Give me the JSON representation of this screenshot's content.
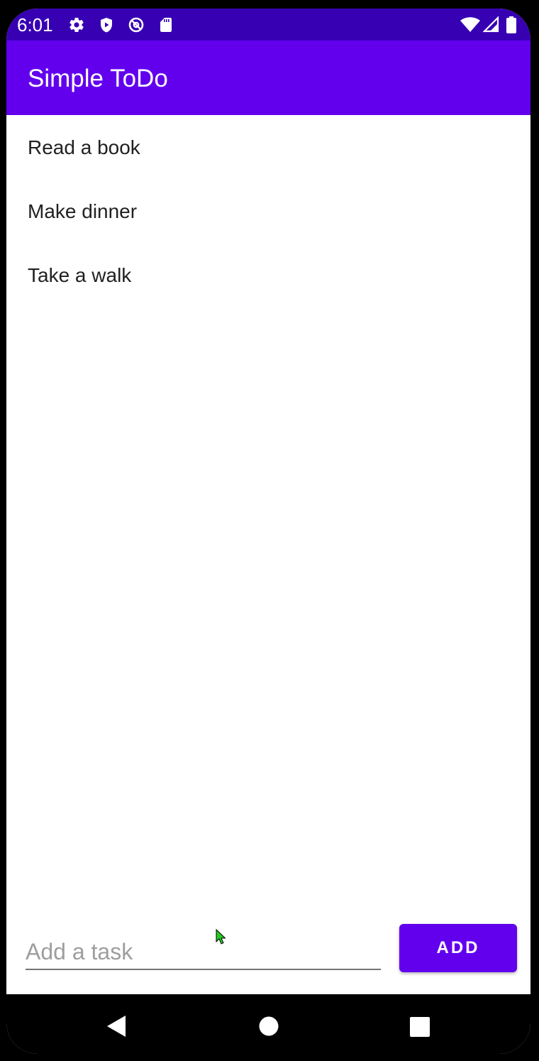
{
  "status_bar": {
    "time": "6:01",
    "left_icons": [
      "gear-icon",
      "shield-play-icon",
      "at-sign-icon",
      "sd-card-icon"
    ],
    "right_icons": [
      "wifi-icon",
      "signal-icon",
      "battery-icon"
    ],
    "color": "#3700b3"
  },
  "app_bar": {
    "title": "Simple ToDo",
    "color": "#6200ee"
  },
  "tasks": [
    {
      "label": "Read a book"
    },
    {
      "label": "Make dinner"
    },
    {
      "label": "Take a walk"
    }
  ],
  "input": {
    "value": "",
    "placeholder": "Add a task"
  },
  "add_button": {
    "label": "ADD",
    "color": "#6200ee"
  },
  "nav_bar": {
    "buttons": [
      "back-icon",
      "home-icon",
      "recents-icon"
    ]
  }
}
